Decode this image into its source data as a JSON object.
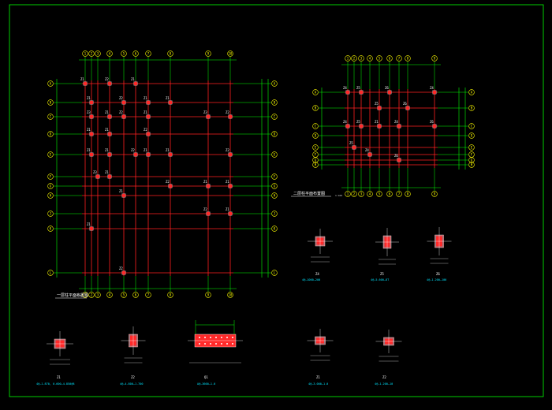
{
  "plans": {
    "left": {
      "title": "一层柱平面布置图",
      "scale": "1:100",
      "col_labels": [
        "1",
        "2",
        "3",
        "4",
        "5",
        "6",
        "7",
        "8",
        "9",
        "10",
        "11",
        "12"
      ],
      "row_labels": [
        "A",
        "B",
        "C",
        "D",
        "E",
        "F",
        "G",
        "H",
        "J",
        "K",
        "L"
      ],
      "zmarks": [
        "Z1",
        "Z2",
        "Z1",
        "Z1",
        "Z2",
        "Z1",
        "Z1",
        "Z3",
        "Z1",
        "Z2",
        "Z1",
        "Z3",
        "Z2",
        "Z1",
        "Z1",
        "Z2",
        "Z1",
        "Z1",
        "Z2",
        "Z1",
        "Z1",
        "Z2",
        "Z3",
        "Z1",
        "Z2",
        "Z1",
        "Z1",
        "Z1",
        "Z2",
        "Z1",
        "Z1",
        "Z2"
      ]
    },
    "right": {
      "title": "二层柱平面布置图",
      "scale": "1:100",
      "col_labels": [
        "1",
        "2",
        "3",
        "4",
        "5",
        "6",
        "7",
        "8",
        "9",
        "10"
      ],
      "row_labels": [
        "A",
        "B",
        "C",
        "D",
        "E",
        "F",
        "G",
        "H"
      ],
      "zmarks": [
        "Z4",
        "Z5",
        "Z6",
        "Z4",
        "Z5",
        "Z6",
        "Z4",
        "Z5",
        "Z1",
        "Z4",
        "Z6",
        "Z5",
        "Z4",
        "Z6"
      ]
    }
  },
  "sections": [
    {
      "label": "Z4",
      "spec": "4@—1000—200"
    },
    {
      "label": "Z5",
      "spec": "4@—5.600—8T"
    },
    {
      "label": "Z6",
      "spec": "4@—1.200—100"
    },
    {
      "label": "Z1",
      "spec": "4@—1.870, 0.600—4.850@8"
    },
    {
      "label": "Z2",
      "spec": "4@—4.800—1.700"
    },
    {
      "label": "Q1",
      "spec": "A@—3600—1.0"
    },
    {
      "label": "Z1",
      "spec": "4@—3.000—1.0"
    },
    {
      "label": "Z2",
      "spec": "4@—1.200—10"
    }
  ]
}
